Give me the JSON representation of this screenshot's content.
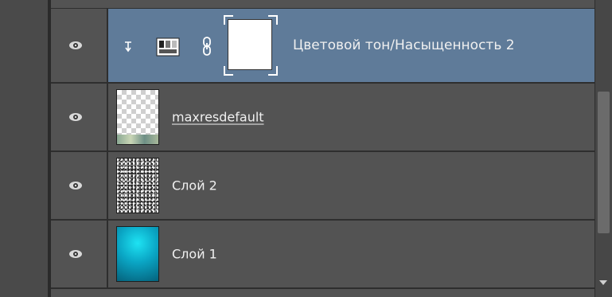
{
  "layers": [
    {
      "name": "Цветовой тон/Насыщенность 2",
      "type": "adjustment",
      "selected": true,
      "visible": true,
      "clipped": true,
      "linked": true
    },
    {
      "name": "maxresdefault",
      "type": "smart-object",
      "selected": false,
      "visible": true,
      "thumbnail": "transparent-checker"
    },
    {
      "name": "Слой 2",
      "type": "pixel",
      "selected": false,
      "visible": true,
      "thumbnail": "noise"
    },
    {
      "name": "Слой 1",
      "type": "pixel",
      "selected": false,
      "visible": true,
      "thumbnail": "cyan-gradient"
    }
  ],
  "colors": {
    "panel_bg": "#535353",
    "selected_bg": "#5f7b99",
    "divider": "#2e2e2e",
    "text": "#f0f0f0"
  },
  "icons": {
    "visibility": "eye-icon",
    "clip": "clipping-arrow-icon",
    "adjustment": "hue-saturation-adjustment-icon",
    "link": "chain-link-icon"
  }
}
